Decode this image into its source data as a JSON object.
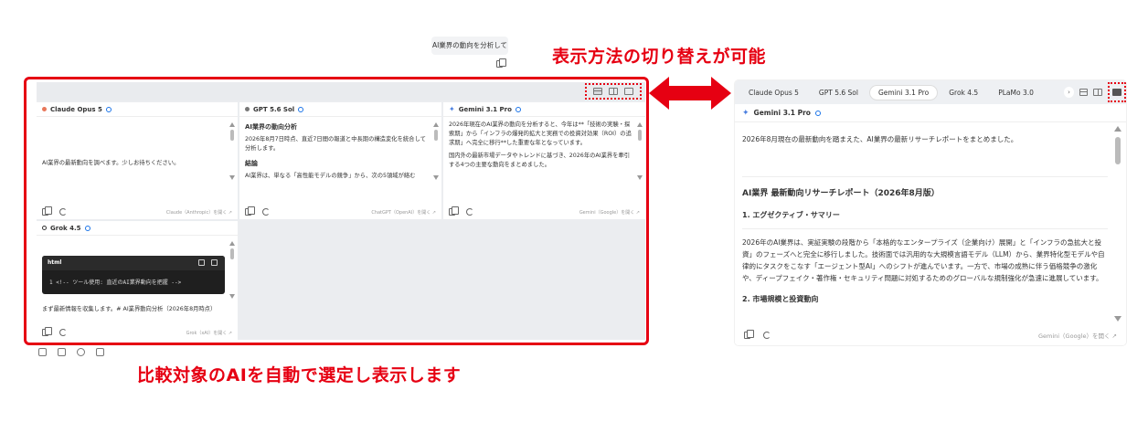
{
  "user_message": "AI業界の動向を分析して",
  "callouts": {
    "top": "表示方法の切り替えが可能",
    "bottom": "比較対象のAIを自動で選定し表示します"
  },
  "grid_panes": [
    {
      "name": "Claude Opus 5",
      "dot_color": "#e8775a",
      "body": "AI業界の最新動向を調べます。少しお待ちください。",
      "source": "Claude（Anthropic）を開く ↗"
    },
    {
      "name": "GPT 5.6 Sol",
      "dot_color": "#777777",
      "heading": "AI業界の動向分析",
      "lines": [
        "2026年8月7日時点、直近7日間の報道と中長期の構造変化を統合して分析します。",
        "結論",
        "AI業界は、単なる「高性能モデルの競争」から、次の5領域が絡む"
      ],
      "source": "ChatGPT（OpenAI）を開く ↗"
    },
    {
      "name": "Gemini 3.1 Pro",
      "dot_color": "#4a7fe0",
      "lines": [
        "2026年現在のAI業界の動向を分析すると、今年は**「技術の実験・探索期」から「インフラの爆発的拡大と実務での投資対効果（ROI）の追求期」へ完全に移行**した重要な年となっています。",
        "国内外の最新市場データやトレンドに基づき、2026年のAI業界を牽引する4つの主要な動向をまとめました。"
      ],
      "source": "Gemini（Google）を開く ↗"
    },
    {
      "name": "Grok 4.5",
      "dot_color": "#333333",
      "code_lang": "html",
      "code_line": "1  <!-- ツール使用: 直近のAI業界動向を把握 -->",
      "body": "まず最新情報を収集します。# AI業界動向分析（2026年8月時点）",
      "source": "Grok（xAI）を開く ↗"
    }
  ],
  "right_panel": {
    "tabs": [
      "Claude Opus 5",
      "GPT 5.6 Sol",
      "Gemini 3.1 Pro",
      "Grok 4.5",
      "PLaMo 3.0"
    ],
    "active_tab": "Gemini 3.1 Pro",
    "pane_name": "Gemini 3.1 Pro",
    "lead": "2026年8月現在の最新動向を踏まえた、AI業界の最新リサーチレポートをまとめました。",
    "title": "AI業界 最新動向リサーチレポート（2026年8月版）",
    "section1": "1. エグゼクティブ・サマリー",
    "para": "2026年のAI業界は、実証実験の段階から「本格的なエンタープライズ（企業向け）展開」と「インフラの急拡大と投資」のフェーズへと完全に移行しました。技術面では汎用的な大規模言語モデル（LLM）から、業界特化型モデルや自律的にタスクをこなす「エージェント型AI」へのシフトが進んでいます。一方で、市場の成熟に伴う価格競争の激化や、ディープフェイク・著作権・セキュリティ問題に対処するためのグローバルな規制強化が急速に進展しています。",
    "section2": "2. 市場規模と投資動向",
    "source": "Gemini（Google）を開く ↗"
  },
  "colors": {
    "accent_red": "#e60012",
    "gemini_blue": "#4a7fe0"
  }
}
